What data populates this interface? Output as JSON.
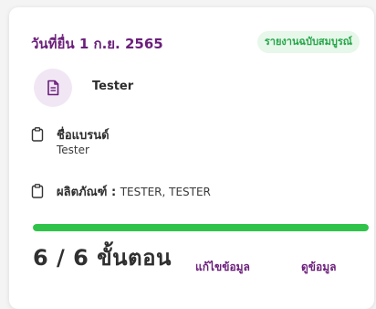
{
  "card": {
    "date_title": "วันที่ยื่น 1 ก.ย. 2565",
    "status_badge": "รายงานฉบับสมบูรณ์",
    "user_name": "Tester",
    "brand_label": "ชื่อแบรนด์",
    "brand_value": "Tester",
    "product_label": "ผลิตภัณฑ์ :",
    "product_value": "TESTER, TESTER",
    "progress_fraction": 1.0,
    "steps_text": "6 / 6 ขั้นตอน",
    "edit_link": "แก้ไขข้อมูล",
    "view_link": "ดูข้อมูล"
  },
  "colors": {
    "accent": "#6b1f7b",
    "badge_text": "#23a547",
    "badge_bg": "#e7f7ea",
    "progress": "#2fc34a",
    "avatar_bg": "#f1e7f4"
  },
  "icons": [
    "document-icon",
    "clipboard-icon"
  ]
}
